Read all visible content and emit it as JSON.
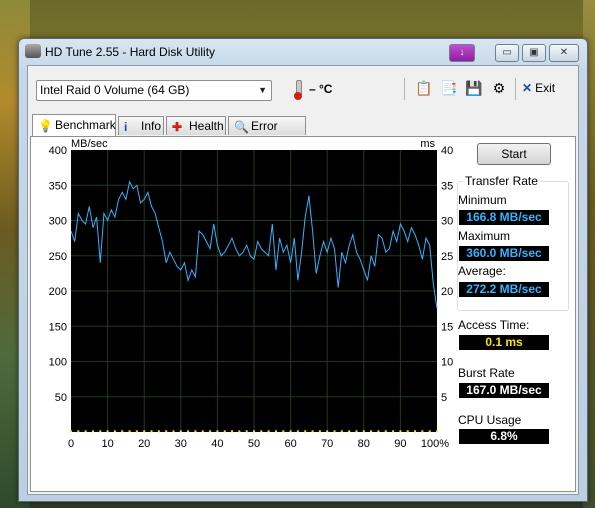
{
  "window": {
    "title": "HD Tune 2.55 - Hard Disk Utility"
  },
  "titlebar_buttons": {
    "minimize": "▭",
    "maximize": "▣",
    "close": "✕"
  },
  "toolbar": {
    "drive": "Intel   Raid 0 Volume (64 GB)",
    "temperature": "– °C",
    "exit_label": "Exit"
  },
  "tabs": [
    {
      "label": "Benchmark",
      "icon": "lightbulb-icon",
      "active": true
    },
    {
      "label": "Info",
      "icon": "info-icon"
    },
    {
      "label": "Health",
      "icon": "health-cross-icon"
    },
    {
      "label": "Error Scan",
      "icon": "magnifier-icon"
    }
  ],
  "side": {
    "start_label": "Start",
    "transfer_title": "Transfer Rate",
    "minimum_label": "Minimum",
    "minimum_value": "166.8 MB/sec",
    "maximum_label": "Maximum",
    "maximum_value": "360.0 MB/sec",
    "average_label": "Average:",
    "average_value": "272.2 MB/sec",
    "access_label": "Access Time:",
    "access_value": "0.1 ms",
    "burst_label": "Burst Rate",
    "burst_value": "167.0 MB/sec",
    "cpu_label": "CPU Usage",
    "cpu_value": "6.8%"
  },
  "colors": {
    "transfer_line": "#3ab0ff",
    "access_points": "#f6e30a",
    "plot_bg": "#000000"
  },
  "chart_data": {
    "type": "line",
    "ylabel_left": "MB/sec",
    "ylabel_right": "ms",
    "y_left_ticks": [
      "400",
      "350",
      "300",
      "250",
      "200",
      "150",
      "100",
      "50"
    ],
    "y_right_ticks": [
      "40",
      "35",
      "30",
      "25",
      "20",
      "15",
      "10",
      "5"
    ],
    "x_ticks": [
      "0",
      "10",
      "20",
      "30",
      "40",
      "50",
      "60",
      "70",
      "80",
      "90",
      "100%"
    ],
    "xlim": [
      0,
      100
    ],
    "ylim_left": [
      0,
      400
    ],
    "ylim_right": [
      0,
      40
    ],
    "grid": true,
    "series": [
      {
        "x": [
          0,
          1,
          2,
          3,
          4,
          5,
          6,
          7,
          8,
          9,
          10,
          11,
          12,
          13,
          14,
          15,
          16,
          17,
          18,
          19,
          20,
          21,
          22,
          23,
          24,
          25,
          26,
          27,
          28,
          29,
          30,
          31,
          32,
          33,
          34,
          35,
          36,
          37,
          38,
          39,
          40,
          41,
          42,
          43,
          44,
          45,
          46,
          47,
          48,
          49,
          50,
          51,
          52,
          53,
          54,
          55,
          56,
          57,
          58,
          59,
          60,
          61,
          62,
          63,
          64,
          65,
          66,
          67,
          68,
          69,
          70,
          71,
          72,
          73,
          74,
          75,
          76,
          77,
          78,
          79,
          80,
          81,
          82,
          83,
          84,
          85,
          86,
          87,
          88,
          89,
          90,
          91,
          92,
          93,
          94,
          95,
          96,
          97,
          98,
          99,
          100
        ],
        "y": [
          285,
          270,
          310,
          300,
          295,
          320,
          290,
          305,
          240,
          310,
          300,
          315,
          305,
          330,
          340,
          330,
          355,
          345,
          350,
          325,
          330,
          340,
          320,
          310,
          290,
          270,
          240,
          255,
          245,
          235,
          230,
          240,
          215,
          230,
          220,
          285,
          280,
          270,
          260,
          295,
          265,
          250,
          255,
          265,
          275,
          260,
          250,
          255,
          265,
          250,
          245,
          270,
          260,
          255,
          250,
          295,
          230,
          275,
          255,
          265,
          240,
          275,
          215,
          255,
          305,
          335,
          285,
          225,
          250,
          270,
          255,
          275,
          260,
          205,
          255,
          240,
          265,
          280,
          255,
          245,
          230,
          215,
          250,
          235,
          280,
          275,
          255,
          260,
          285,
          270,
          295,
          285,
          270,
          290,
          280,
          265,
          245,
          275,
          265,
          210,
          175
        ]
      },
      {
        "name": "access",
        "x": [
          0,
          2,
          4,
          6,
          8,
          10,
          12,
          14,
          16,
          18,
          20,
          22,
          24,
          26,
          28,
          30,
          32,
          34,
          36,
          38,
          40,
          42,
          44,
          46,
          48,
          50,
          52,
          54,
          56,
          58,
          60,
          62,
          64,
          66,
          68,
          70,
          72,
          74,
          76,
          78,
          80,
          82,
          84,
          86,
          88,
          90,
          92,
          94,
          96,
          98,
          100
        ],
        "y": [
          0.1,
          0.1,
          0.1,
          0.1,
          0.1,
          0.1,
          0.1,
          0.1,
          0.1,
          0.1,
          0.1,
          0.1,
          0.1,
          0.1,
          0.1,
          0.1,
          0.1,
          0.1,
          0.1,
          0.1,
          0.1,
          0.1,
          0.1,
          0.1,
          0.1,
          0.1,
          0.1,
          0.1,
          0.1,
          0.1,
          0.1,
          0.1,
          0.1,
          0.1,
          0.1,
          0.1,
          0.1,
          0.1,
          0.1,
          0.1,
          0.1,
          0.1,
          0.1,
          0.1,
          0.1,
          0.1,
          0.1,
          0.1,
          0.1,
          0.1,
          0.1
        ]
      }
    ]
  }
}
